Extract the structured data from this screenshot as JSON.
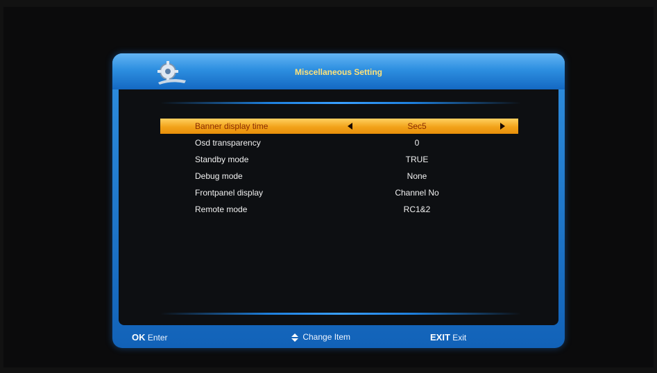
{
  "dialog": {
    "title": "Miscellaneous Setting",
    "logo_icon": "gear-wrench-icon"
  },
  "settings": [
    {
      "label": "Banner display time",
      "value": "Sec5",
      "selected": true
    },
    {
      "label": "Osd transparency",
      "value": "0",
      "selected": false
    },
    {
      "label": "Standby mode",
      "value": "TRUE",
      "selected": false
    },
    {
      "label": "Debug mode",
      "value": "None",
      "selected": false
    },
    {
      "label": "Frontpanel display",
      "value": "Channel No",
      "selected": false
    },
    {
      "label": "Remote mode",
      "value": "RC1&2",
      "selected": false
    }
  ],
  "footer": {
    "ok_key": "OK",
    "ok_text": "Enter",
    "change_icon": "up-down-arrow-icon",
    "change_text": "Change Item",
    "exit_key": "EXIT",
    "exit_text": "Exit"
  },
  "colors": {
    "frame_blue": "#1f7ad6",
    "highlight_orange": "#f2a31a",
    "title_text": "#ffe27a"
  }
}
